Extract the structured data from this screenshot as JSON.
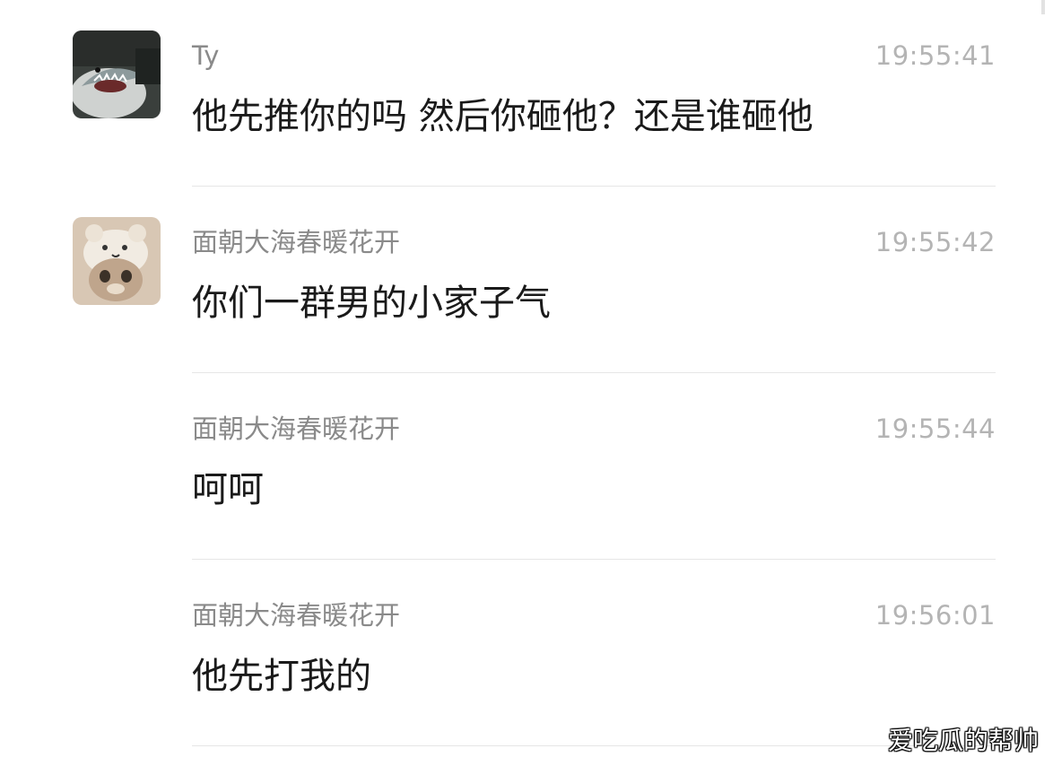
{
  "messages": [
    {
      "sender": "Ty",
      "time": "19:55:41",
      "text": "他先推你的吗 然后你砸他？还是谁砸他",
      "avatar": "shark-avatar-icon"
    },
    {
      "sender": "面朝大海春暖花开",
      "time": "19:55:42",
      "text": "你们一群男的小家子气",
      "avatar": "cat-avatar-icon"
    },
    {
      "sender": "面朝大海春暖花开",
      "time": "19:55:44",
      "text": "呵呵",
      "avatar": ""
    },
    {
      "sender": "面朝大海春暖花开",
      "time": "19:56:01",
      "text": "他先打我的",
      "avatar": ""
    }
  ],
  "watermark": "爱吃瓜的帮帅"
}
